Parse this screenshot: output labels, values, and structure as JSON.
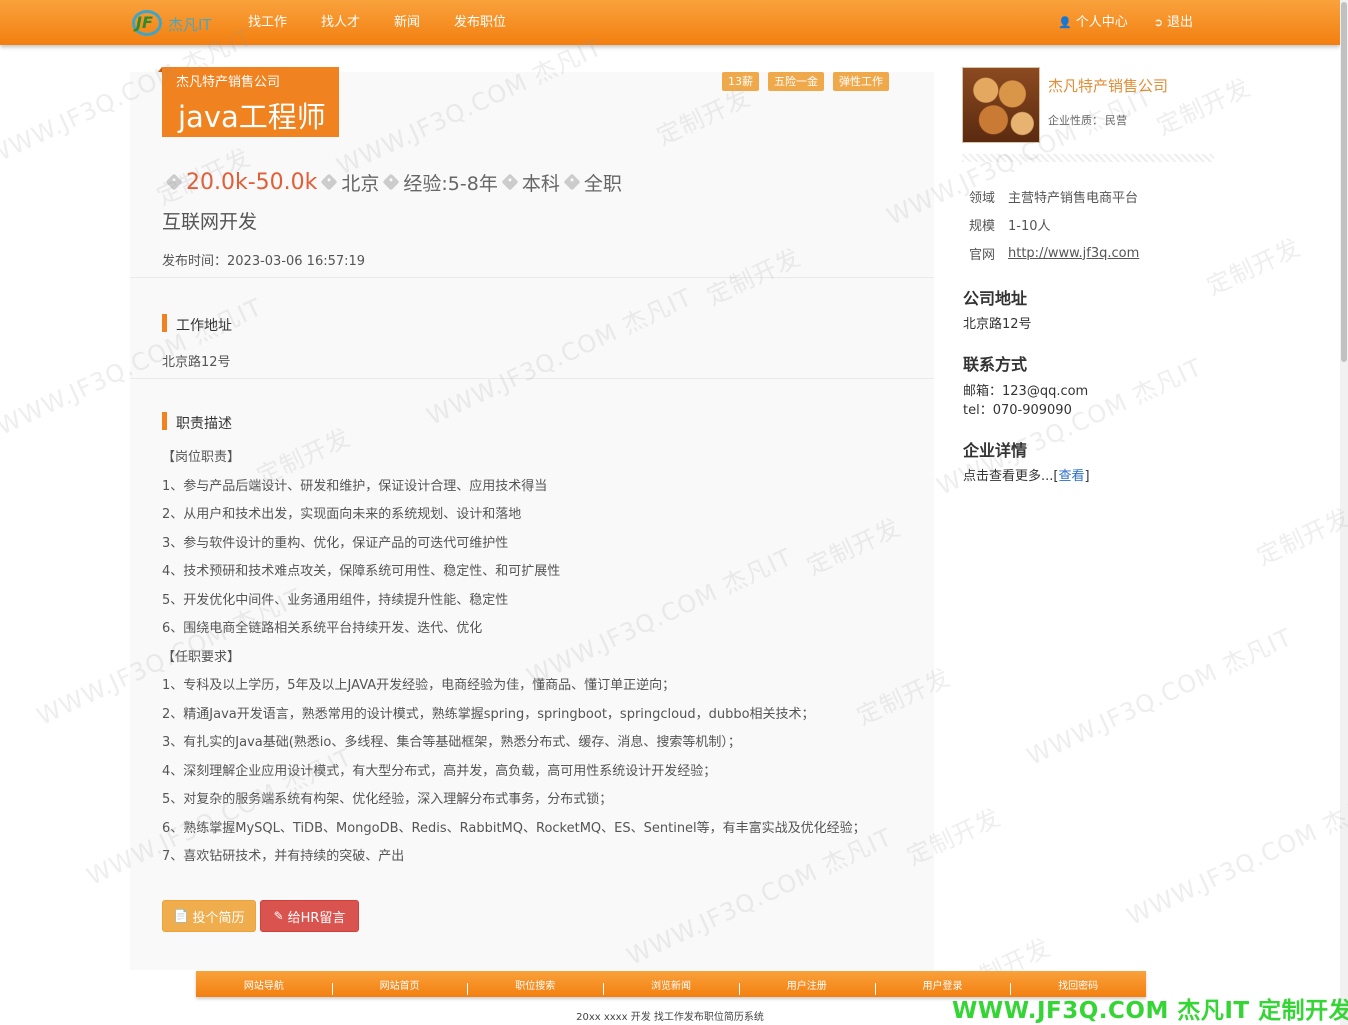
{
  "nav": {
    "logo_text": "杰凡IT",
    "items": [
      "找工作",
      "找人才",
      "新闻",
      "发布职位"
    ],
    "user_center": "个人中心",
    "logout": "退出"
  },
  "job": {
    "company": "杰凡特产销售公司",
    "title": "java工程师",
    "welfare": [
      "13薪",
      "五险一金",
      "弹性工作"
    ],
    "salary": "20.0k-50.0k",
    "city": "北京",
    "experience": "经验:5-8年",
    "education": "本科",
    "type": "全职",
    "department": "互联网开发",
    "publish_time": "发布时间：2023-03-06 16:57:19",
    "address_title": "工作地址",
    "address": "北京路12号",
    "duty_title": "职责描述",
    "duties": [
      "【岗位职责】",
      "1、参与产品后端设计、研发和维护，保证设计合理、应用技术得当",
      "2、从用户和技术出发，实现面向未来的系统规划、设计和落地",
      "3、参与软件设计的重构、优化，保证产品的可迭代可维护性",
      "4、技术预研和技术难点攻关，保障系统可用性、稳定性、和可扩展性",
      "5、开发优化中间件、业务通用组件，持续提升性能、稳定性",
      "6、围绕电商全链路相关系统平台持续开发、迭代、优化",
      "【任职要求】",
      "1、专科及以上学历，5年及以上JAVA开发经验，电商经验为佳，懂商品、懂订单正逆向；",
      "2、精通Java开发语言，熟悉常用的设计模式，熟练掌握spring，springboot，springcloud，dubbo相关技术；",
      "3、有扎实的Java基础(熟悉io、多线程、集合等基础框架，熟悉分布式、缓存、消息、搜索等机制）；",
      "4、深刻理解企业应用设计模式，有大型分布式，高并发，高负载，高可用性系统设计开发经验；",
      "5、对复杂的服务端系统有构架、优化经验，深入理解分布式事务，分布式锁；",
      "6、熟练掌握MySQL、TiDB、MongoDB、Redis、RabbitMQ、RocketMQ、ES、Sentinel等，有丰富实战及优化经验；",
      "7、喜欢钻研技术，并有持续的突破、产出"
    ],
    "apply_label": "投个简历",
    "message_label": "给HR留言"
  },
  "company": {
    "name": "杰凡特产销售公司",
    "nature_label": "企业性质：",
    "nature": "民营",
    "field_label": "领域",
    "field": "主营特产销售电商平台",
    "scale_label": "规模",
    "scale": "1-10人",
    "site_label": "官网",
    "site": "http://www.jf3q.com",
    "addr_title": "公司地址",
    "addr": "北京路12号",
    "contact_title": "联系方式",
    "email": "邮箱：123@qq.com",
    "tel": "tel：070-909090",
    "detail_title": "企业详情",
    "detail_text": "点击查看更多...[",
    "detail_link": "查看",
    "detail_end": "]"
  },
  "footer": {
    "links": [
      "网站导航",
      "网站首页",
      "职位搜索",
      "浏览新闻",
      "用户注册",
      "用户登录",
      "找回密码"
    ],
    "copyright": "20xx xxxx 开发 找工作发布职位简历系统"
  },
  "watermark": {
    "site": "WWW.JF3Q.COM 杰凡IT",
    "custom": "定制开发",
    "bottom": "WWW.JF3Q.COM 杰凡IT  定制开发"
  },
  "colors": {
    "accent": "#f08220",
    "salary": "#e35d35",
    "welfare": "#f0a94a",
    "apply": "#f0ad4e",
    "message": "#d9534f"
  }
}
